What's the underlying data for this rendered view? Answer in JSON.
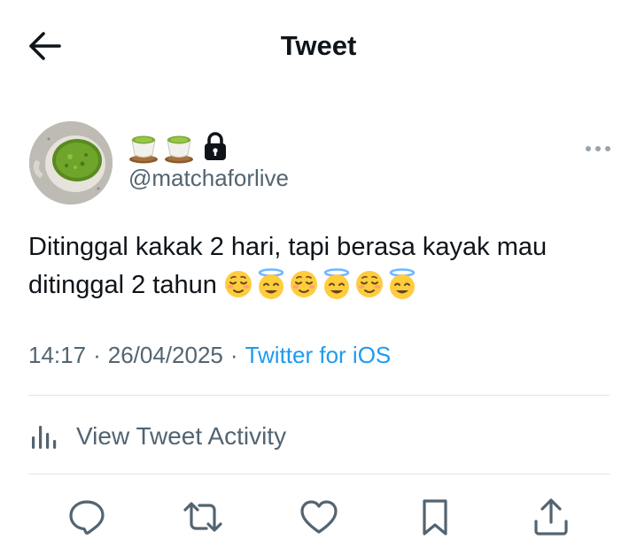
{
  "header": {
    "title": "Tweet",
    "back_icon": "arrow-left-icon"
  },
  "author": {
    "display_name_icons": [
      "tea-cup-icon",
      "tea-cup-icon",
      "lock-icon"
    ],
    "username": "@matchaforlive",
    "avatar_icon": "matcha-cup-avatar"
  },
  "tweet": {
    "text": "Ditinggal kakak 2 hari, tapi berasa kayak mau ditinggal 2 tahun",
    "emojis": [
      "relieved-face",
      "halo-face",
      "relieved-face",
      "halo-face",
      "relieved-face",
      "halo-face"
    ]
  },
  "meta": {
    "time": "14:17",
    "separator": "·",
    "date": "26/04/2025",
    "source": "Twitter for iOS"
  },
  "activity": {
    "label": "View Tweet Activity",
    "icon": "analytics-icon"
  },
  "actions": [
    "reply-icon",
    "retweet-icon",
    "like-icon",
    "bookmark-icon",
    "share-icon"
  ],
  "colors": {
    "text": "#0f1419",
    "secondary": "#536471",
    "link": "#1d9bf0",
    "divider": "#e1e5e8"
  }
}
